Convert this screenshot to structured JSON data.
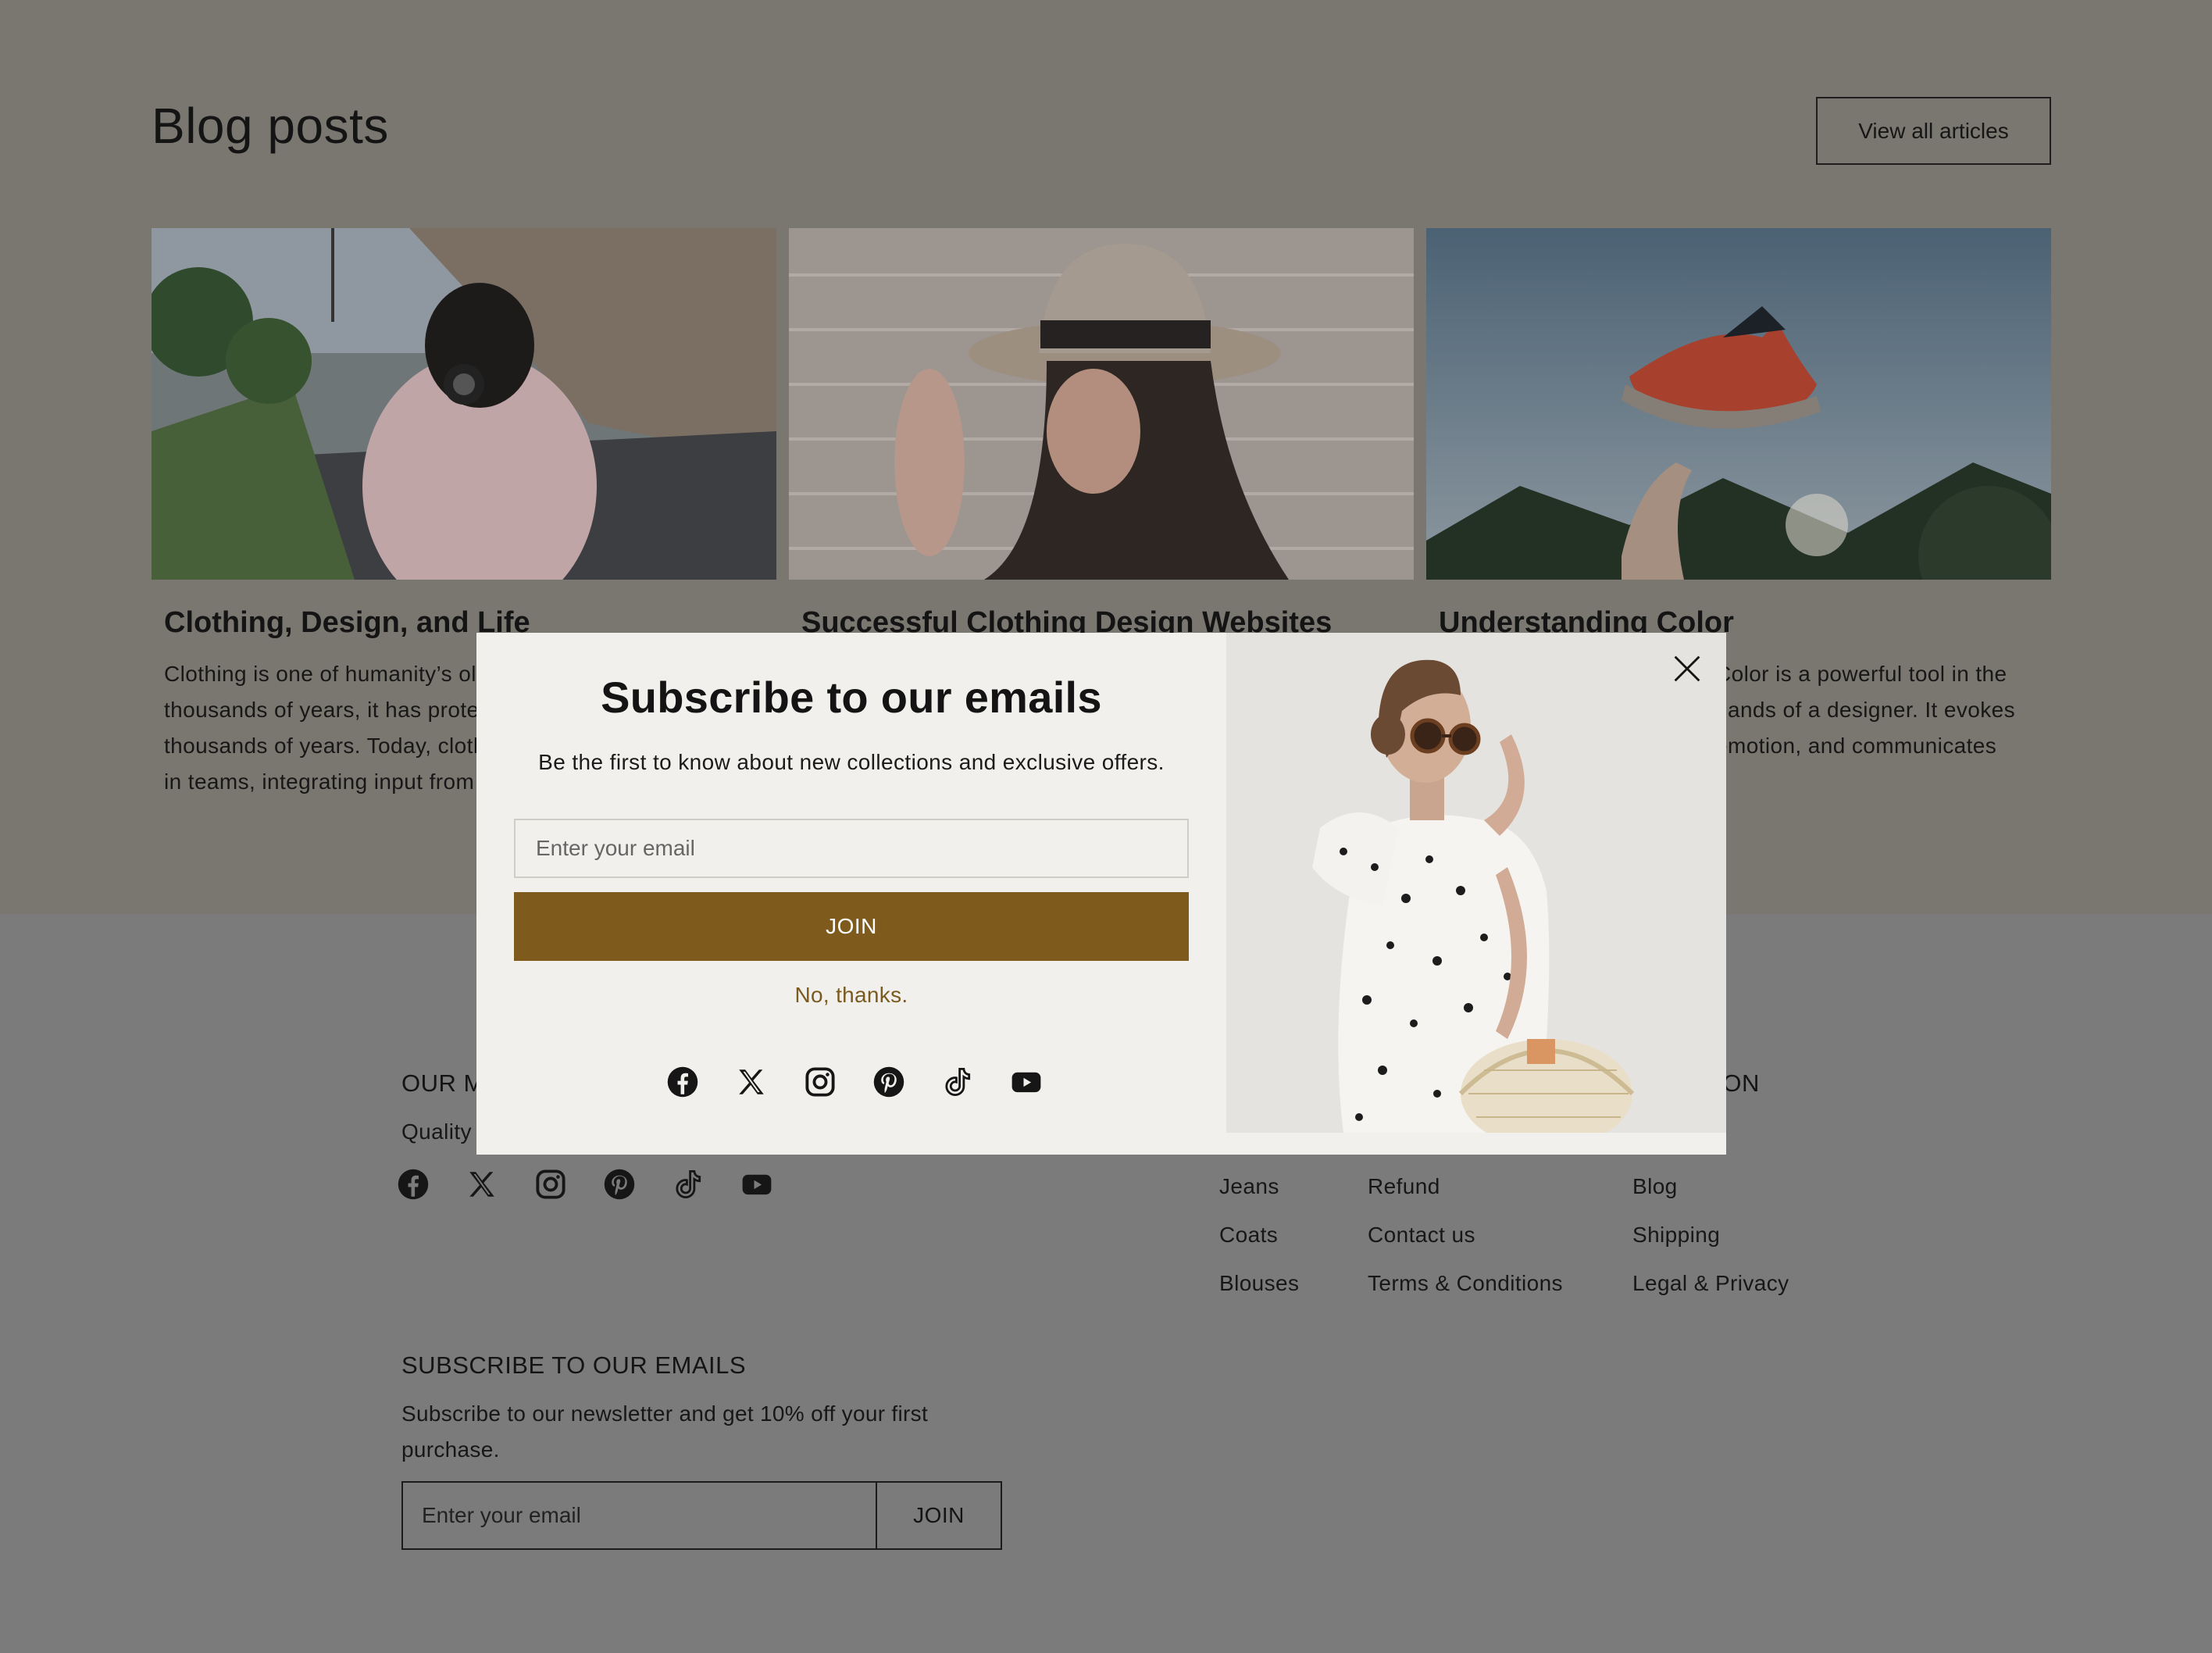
{
  "blog": {
    "title": "Blog posts",
    "view_all_label": "View all articles",
    "posts": [
      {
        "title": "Clothing, Design, and Life",
        "excerpt": "Clothing is one of humanity’s oldest art forms. For thousands of years, it has protected our bodies for thousands of years. Today, clothing designers are working in teams, integrating input from every area of business."
      },
      {
        "title": "Successful Clothing Design Websites",
        "excerpt": ""
      },
      {
        "title": "Understanding Color",
        "excerpt": "Color is a powerful tool in the hands of a designer. It evokes emotion, and communicates"
      }
    ]
  },
  "footer": {
    "mission_heading": "OUR M",
    "mission_text": "Quality",
    "info_heading": "ATION",
    "links_col1": [
      "Jeans",
      "Coats",
      "Blouses"
    ],
    "links_col2": [
      "Refund",
      "Contact us",
      "Terms & Conditions"
    ],
    "links_col3": [
      "Blog",
      "Shipping",
      "Legal & Privacy"
    ],
    "subscribe_heading": "SUBSCRIBE TO OUR EMAILS",
    "subscribe_text": "Subscribe to our newsletter and get 10% off your first purchase.",
    "email_placeholder": "Enter your email",
    "join_label": "JOIN"
  },
  "modal": {
    "title": "Subscribe to our emails",
    "description": "Be the first to know about new collections and exclusive offers.",
    "email_placeholder": "Enter your email",
    "join_label": "JOIN",
    "no_thanks_label": "No, thanks."
  },
  "social_icons": [
    "facebook-icon",
    "x-icon",
    "instagram-icon",
    "pinterest-icon",
    "tiktok-icon",
    "youtube-icon"
  ],
  "colors": {
    "accent": "#7e5a1c",
    "overlay_bg": "#7b7b7b",
    "modal_bg": "#f2f0ec"
  }
}
